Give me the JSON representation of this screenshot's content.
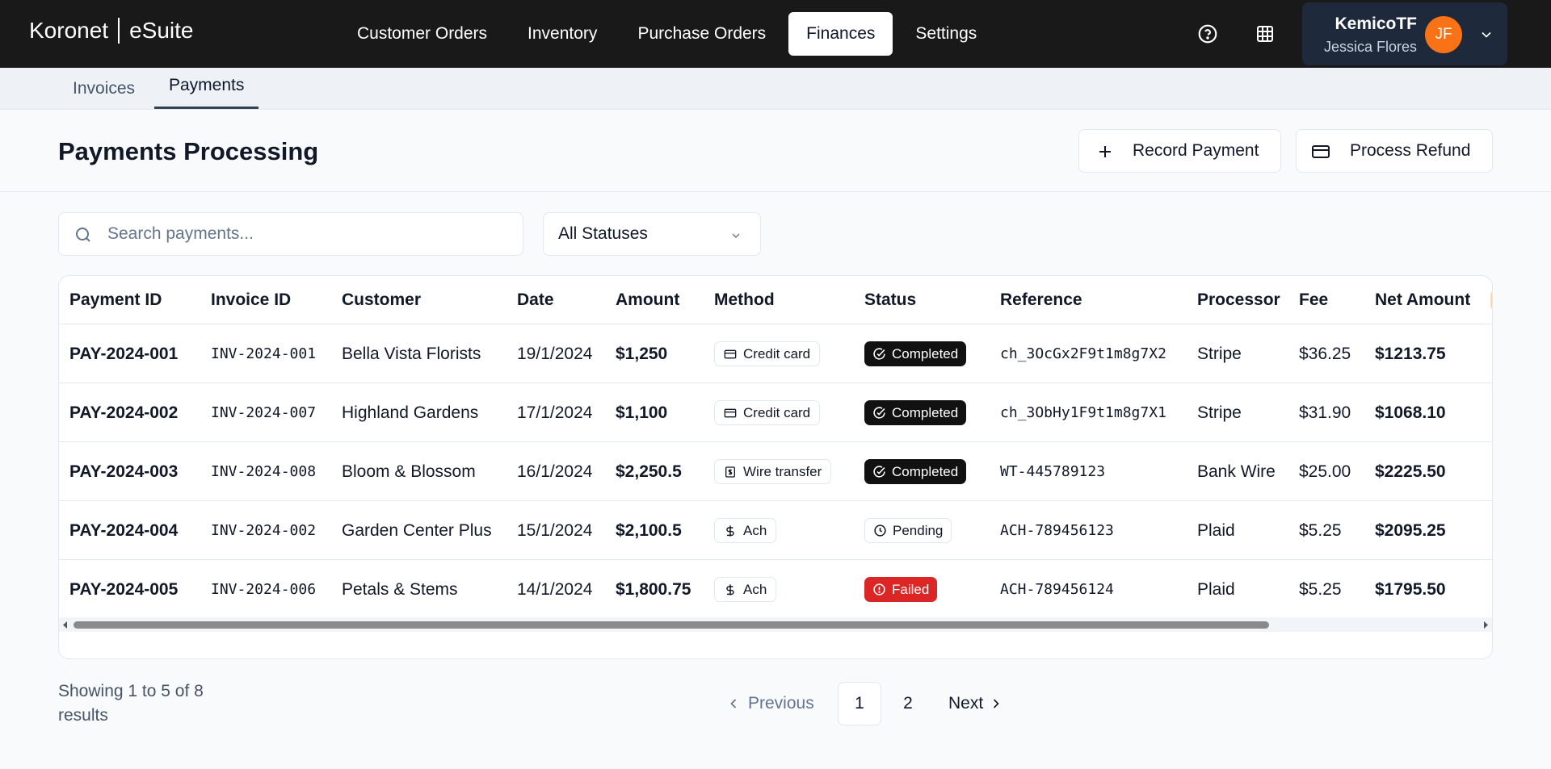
{
  "brand": {
    "left": "Koronet",
    "right": "eSuite"
  },
  "nav": {
    "items": [
      {
        "label": "Customer Orders",
        "active": false
      },
      {
        "label": "Inventory",
        "active": false
      },
      {
        "label": "Purchase Orders",
        "active": false
      },
      {
        "label": "Finances",
        "active": true
      },
      {
        "label": "Settings",
        "active": false
      }
    ],
    "icons": [
      "help-circle-icon",
      "grid-icon"
    ]
  },
  "user": {
    "org": "KemicoTF",
    "name": "Jessica Flores",
    "initials": "JF",
    "avatar_color": "#f97316"
  },
  "subtabs": [
    {
      "label": "Invoices",
      "active": false
    },
    {
      "label": "Payments",
      "active": true
    }
  ],
  "header": {
    "title": "Payments Processing",
    "record_label": "Record Payment",
    "refund_label": "Process Refund"
  },
  "filters": {
    "search_placeholder": "Search payments...",
    "search_value": "",
    "status_selected": "All Statuses"
  },
  "table": {
    "columns": [
      "Payment ID",
      "Invoice ID",
      "Customer",
      "Date",
      "Amount",
      "Method",
      "Status",
      "Reference",
      "Processor",
      "Fee",
      "Net Amount"
    ],
    "rows": [
      {
        "payment_id": "PAY-2024-001",
        "invoice_id": "INV-2024-001",
        "customer": "Bella Vista Florists",
        "date": "19/1/2024",
        "amount": "$1,250",
        "method": "Credit card",
        "method_icon": "credit-card-icon",
        "status": "Completed",
        "reference": "ch_3OcGx2F9t1m8g7X2",
        "processor": "Stripe",
        "fee": "$36.25",
        "net": "$1213.75"
      },
      {
        "payment_id": "PAY-2024-002",
        "invoice_id": "INV-2024-007",
        "customer": "Highland Gardens",
        "date": "17/1/2024",
        "amount": "$1,100",
        "method": "Credit card",
        "method_icon": "credit-card-icon",
        "status": "Completed",
        "reference": "ch_3ObHy1F9t1m8g7X1",
        "processor": "Stripe",
        "fee": "$31.90",
        "net": "$1068.10"
      },
      {
        "payment_id": "PAY-2024-003",
        "invoice_id": "INV-2024-008",
        "customer": "Bloom & Blossom",
        "date": "16/1/2024",
        "amount": "$2,250.5",
        "method": "Wire transfer",
        "method_icon": "bank-note-icon",
        "status": "Completed",
        "reference": "WT-445789123",
        "processor": "Bank Wire",
        "fee": "$25.00",
        "net": "$2225.50"
      },
      {
        "payment_id": "PAY-2024-004",
        "invoice_id": "INV-2024-002",
        "customer": "Garden Center Plus",
        "date": "15/1/2024",
        "amount": "$2,100.5",
        "method": "Ach",
        "method_icon": "dollar-icon",
        "status": "Pending",
        "reference": "ACH-789456123",
        "processor": "Plaid",
        "fee": "$5.25",
        "net": "$2095.25"
      },
      {
        "payment_id": "PAY-2024-005",
        "invoice_id": "INV-2024-006",
        "customer": "Petals & Stems",
        "date": "14/1/2024",
        "amount": "$1,800.75",
        "method": "Ach",
        "method_icon": "dollar-icon",
        "status": "Failed",
        "reference": "ACH-789456124",
        "processor": "Plaid",
        "fee": "$5.25",
        "net": "$1795.50"
      }
    ]
  },
  "status_colors": {
    "Completed": "#111111",
    "Pending": "#ffffff",
    "Failed": "#dc2626"
  },
  "footer": {
    "showing": "Showing 1 to 5 of 8 results",
    "prev_label": "Previous",
    "next_label": "Next",
    "pages": [
      "1",
      "2"
    ],
    "current_page": "1"
  }
}
